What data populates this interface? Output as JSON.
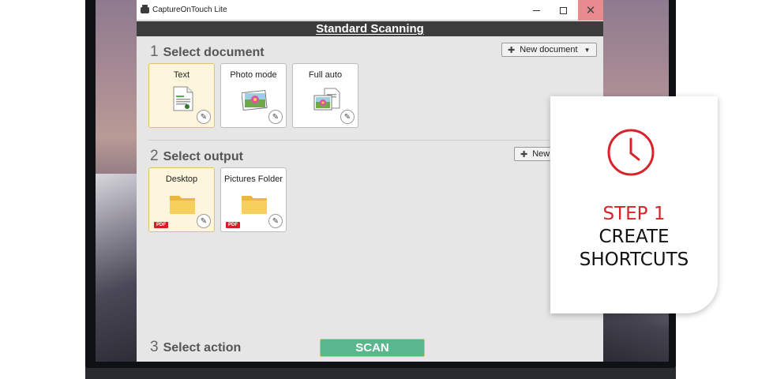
{
  "window": {
    "title": "CaptureOnTouch Lite",
    "close_glyph": "✕"
  },
  "header": {
    "title": "Standard Scanning"
  },
  "section1": {
    "number": "1",
    "title": "Select document",
    "new_button": "New document",
    "tiles": [
      {
        "label": "Text",
        "icon": "text-document-icon",
        "selected": true
      },
      {
        "label": "Photo mode",
        "icon": "photo-icon",
        "selected": false
      },
      {
        "label": "Full auto",
        "icon": "auto-document-icon",
        "selected": false
      }
    ]
  },
  "section2": {
    "number": "2",
    "title": "Select output",
    "new_button": "New",
    "tiles": [
      {
        "label": "Desktop",
        "icon": "folder-icon",
        "badge": "PDF",
        "selected": true
      },
      {
        "label": "Pictures Folder",
        "icon": "folder-icon",
        "badge": "PDF",
        "selected": false
      }
    ]
  },
  "section3": {
    "number": "3",
    "title": "Select action",
    "scan_button": "SCAN"
  },
  "overlay": {
    "step": "STEP 1",
    "line1": "CREATE",
    "line2": "SHORTCUTS",
    "accent_color": "#d8232a"
  }
}
